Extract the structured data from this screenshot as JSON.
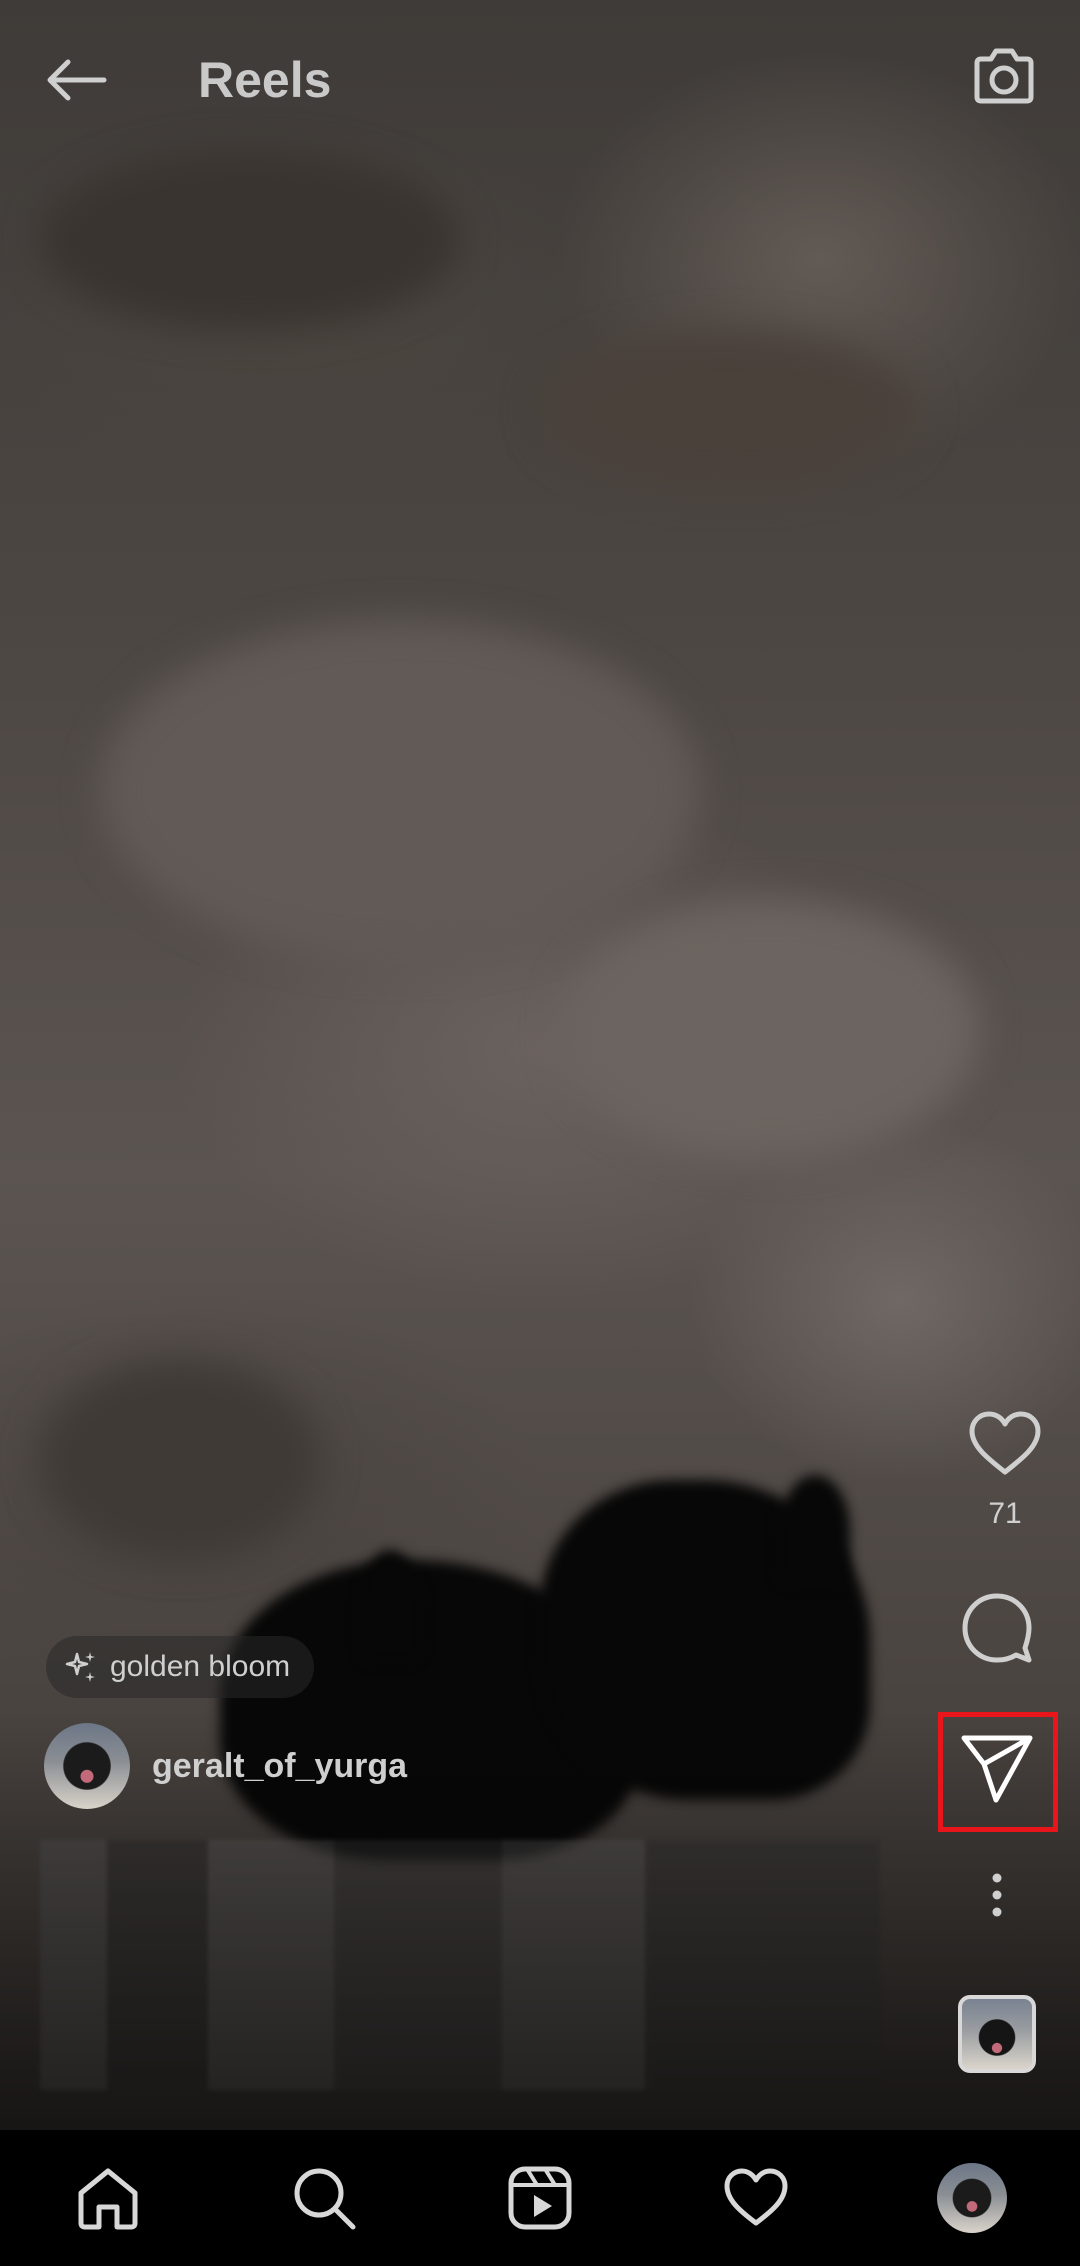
{
  "header": {
    "title": "Reels",
    "back_icon": "arrow-left-icon",
    "camera_icon": "camera-icon"
  },
  "reel": {
    "audio_label": "golden bloom",
    "author": "geralt_of_yurga",
    "like_count": "71"
  },
  "actions": {
    "like_icon": "heart-icon",
    "comment_icon": "comment-icon",
    "share_icon": "send-icon",
    "more_icon": "more-vertical-icon",
    "highlight_color": "#e8151b"
  },
  "bottom_nav": {
    "items": [
      "home-icon",
      "search-icon",
      "reels-icon",
      "activity-heart-icon",
      "profile-avatar"
    ]
  }
}
